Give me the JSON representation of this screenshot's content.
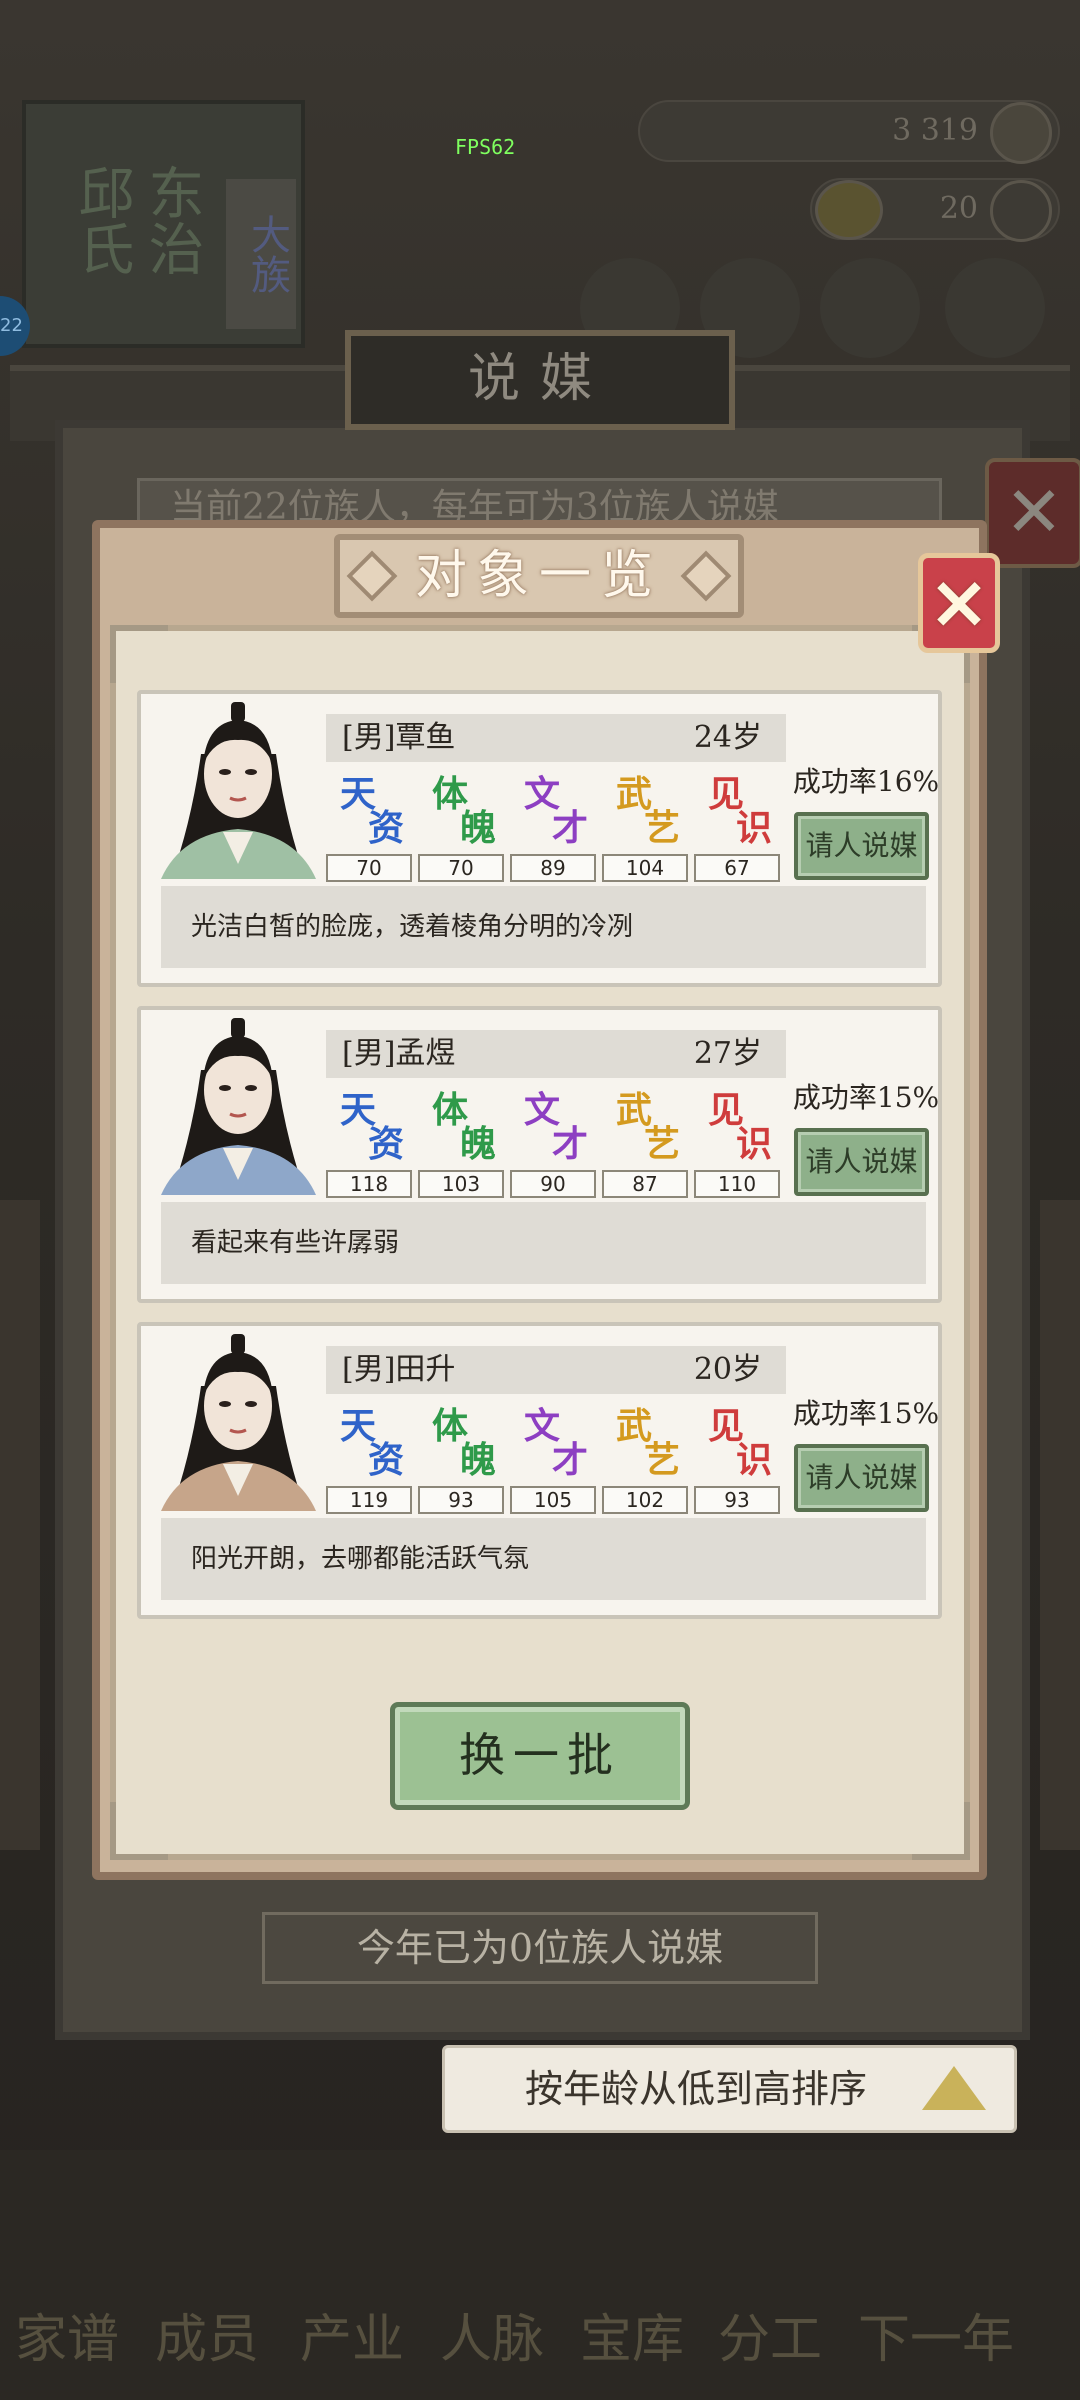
{
  "colors": {
    "stat_talent": "#2f63c9",
    "stat_physique": "#2f9a4a",
    "stat_literary": "#8d3fc2",
    "stat_martial": "#d49a1f",
    "stat_knowledge": "#cf3c3c",
    "button_green": "#8eb08a",
    "close_red": "#c9414a"
  },
  "background": {
    "book_label": "东治 邱氏",
    "book_label2": "大族",
    "fps": "FPS62",
    "resource1": "3 319",
    "resource2": "20",
    "badge": "22",
    "outer_title": "说媒",
    "outer_subtitle": "当前22位族人，每年可为3位族人说媒",
    "outer_note": "今年已为0位族人说媒",
    "sort_label": "按年龄从低到高排序",
    "nav": [
      "家谱",
      "成员",
      "产业",
      "人脉",
      "宝库",
      "分工",
      "下一年"
    ]
  },
  "dialog": {
    "title": "对象一览",
    "close_icon": "×",
    "refresh_label": "换一批"
  },
  "stat_labels": [
    {
      "c1": "天",
      "c2": "资"
    },
    {
      "c1": "体",
      "c2": "魄"
    },
    {
      "c1": "文",
      "c2": "才"
    },
    {
      "c1": "武",
      "c2": "艺"
    },
    {
      "c1": "见",
      "c2": "识"
    }
  ],
  "candidates": [
    {
      "name": "[男]覃鱼",
      "age": "24岁",
      "stats": [
        "70",
        "70",
        "89",
        "104",
        "67"
      ],
      "success_rate": "成功率16%",
      "button": "请人说媒",
      "description": "光洁白皙的脸庞，透着棱角分明的冷冽",
      "robe_color": "#9fc0a4"
    },
    {
      "name": "[男]孟煜",
      "age": "27岁",
      "stats": [
        "118",
        "103",
        "90",
        "87",
        "110"
      ],
      "success_rate": "成功率15%",
      "button": "请人说媒",
      "description": "看起来有些许孱弱",
      "robe_color": "#8ea7c9"
    },
    {
      "name": "[男]田升",
      "age": "20岁",
      "stats": [
        "119",
        "93",
        "105",
        "102",
        "93"
      ],
      "success_rate": "成功率15%",
      "button": "请人说媒",
      "description": "阳光开朗，去哪都能活跃气氛",
      "robe_color": "#c6a58a"
    }
  ]
}
